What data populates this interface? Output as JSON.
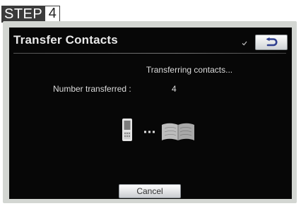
{
  "step": {
    "label": "STEP",
    "number": "4"
  },
  "screen": {
    "title": "Transfer Contacts",
    "status": "Transferring contacts...",
    "count_label": "Number transferred :",
    "count_value": "4",
    "cancel_label": "Cancel",
    "back_icon": "back-arrow-icon",
    "phone_icon": "mobile-phone-icon",
    "book_icon": "address-book-icon"
  },
  "colors": {
    "display_bg": "#070707",
    "bezel": "#d3d6d2",
    "button_top": "#ffffff",
    "button_bottom": "#c9ccd0",
    "back_arrow": "#2f3f8f"
  }
}
